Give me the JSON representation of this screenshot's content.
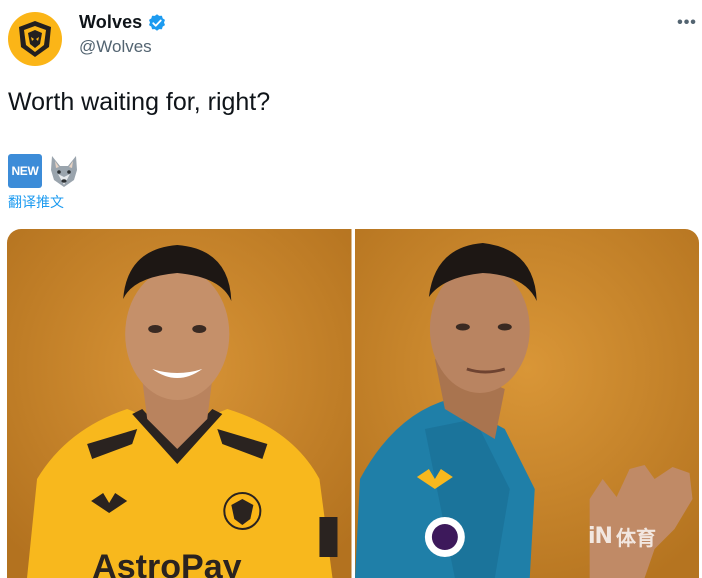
{
  "tweet": {
    "author": {
      "display_name": "Wolves",
      "handle": "@Wolves",
      "verified": true,
      "avatar_icon": "wolves-crest-icon"
    },
    "more_label": "•••",
    "text": "Worth waiting for, right?",
    "emoji": [
      "new-button-emoji",
      "wolf-emoji"
    ],
    "new_badge_label": "NEW",
    "translate_label": "翻译推文",
    "media": [
      {
        "description_icon": "player-home-kit-photo",
        "shirt_sponsor": "AstroPay"
      },
      {
        "description_icon": "player-away-kit-photo"
      }
    ]
  },
  "watermark": {
    "logo": "iN",
    "text": "体育"
  },
  "colors": {
    "brand_gold": "#fbb517",
    "link_blue": "#1d9bf0",
    "photo_bg": "#c9862a",
    "away_kit": "#1f7fa8"
  }
}
